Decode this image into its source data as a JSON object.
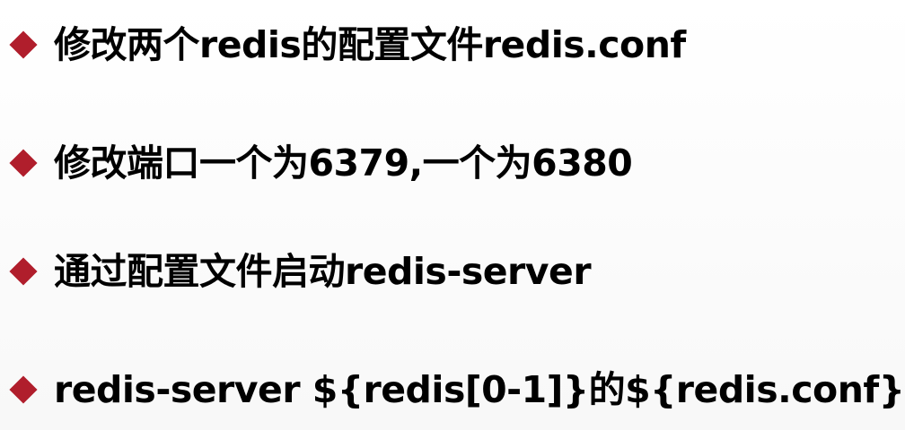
{
  "colors": {
    "bullet": "#b01e2c",
    "text": "#000000",
    "background": "#ffffff"
  },
  "bullets": [
    {
      "icon": "diamond-bullet-icon",
      "text": "修改两个redis的配置文件redis.conf"
    },
    {
      "icon": "diamond-bullet-icon",
      "text": "修改端口一个为6379,一个为6380"
    },
    {
      "icon": "diamond-bullet-icon",
      "text": "通过配置文件启动redis-server"
    },
    {
      "icon": "diamond-bullet-icon",
      "text": "redis-server ${redis[0-1]}的${redis.conf}"
    }
  ]
}
